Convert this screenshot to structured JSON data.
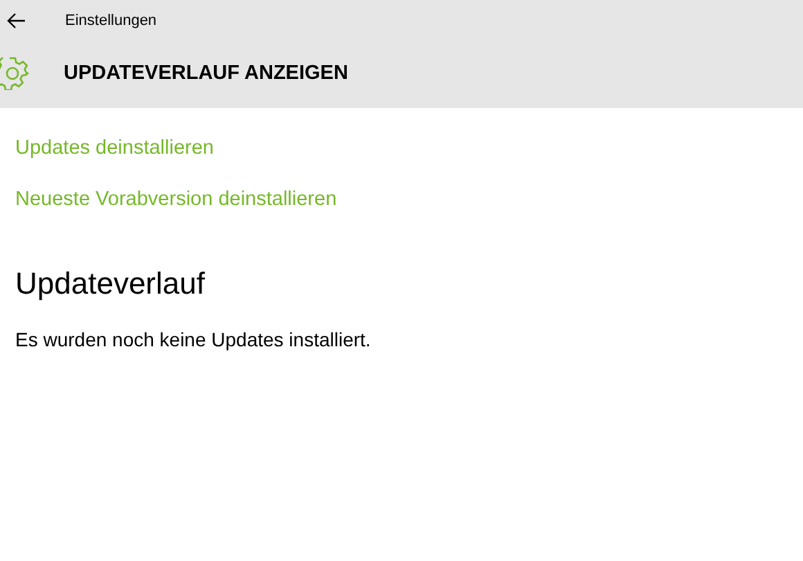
{
  "window": {
    "title": "Einstellungen"
  },
  "header": {
    "title": "UPDATEVERLAUF ANZEIGEN"
  },
  "links": [
    {
      "label": "Updates deinstallieren"
    },
    {
      "label": "Neueste Vorabversion deinstallieren"
    }
  ],
  "section": {
    "heading": "Updateverlauf",
    "message": "Es wurden noch keine Updates installiert."
  }
}
